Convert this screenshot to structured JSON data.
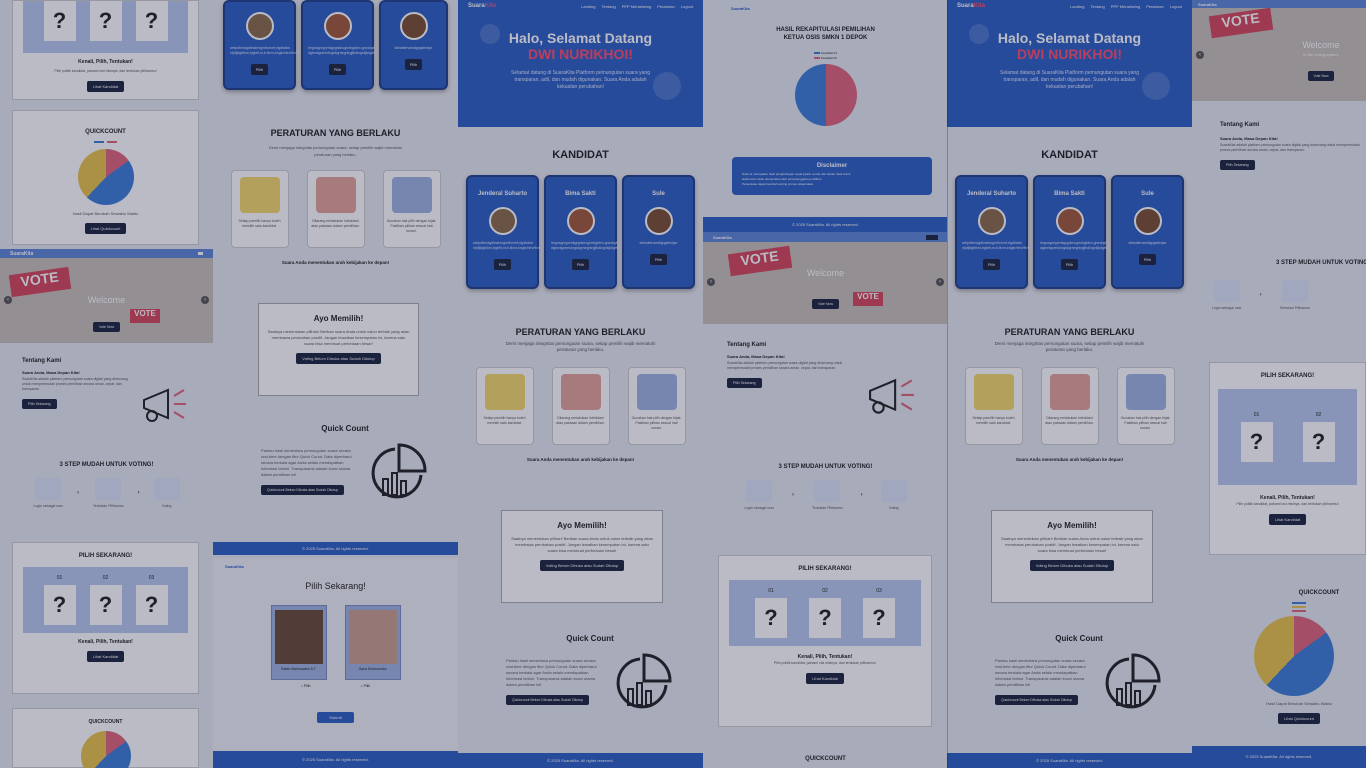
{
  "hero": {
    "brand_prefix": "Suara",
    "brand_suffix": "Kita",
    "nav": [
      "Landing",
      "Tentang",
      "PPP Meraelwing",
      "Peraturan",
      "Logout"
    ],
    "greeting": "Halo, Selamat Datang",
    "user": "DWI NURIKHOI!",
    "intro": "Selamat datang di SuaraKita Platform pemungutan suara yang transparan, adil, dan mudah digunakan. Suara Anda adalah kekuatan perubahan!"
  },
  "candidates": {
    "title": "KANDIDAT",
    "items": [
      {
        "name": "Jenderal Suharto",
        "desc": "welpdfendgdfvwkrngmtfurnrrf,rtgdfwkw nfjdfjdgfdkrn,trgbfrt,nr,b.tkrnr,bngkr/ntrvrfivrfnkrvkhwrkfvkrfg",
        "button": "Pilih"
      },
      {
        "name": "Bima Sakti",
        "desc": "hegnagnrgnrnkgrgnknuglnrbgbkrn,grsrdrgb dgknrkgnerkdngkkgrnegrkrgjfkdkrgnkjkdgtfnkfnf",
        "button": "Pilih"
      },
      {
        "name": "Sule",
        "desc": "sfdwdlerwmdlgrgwfwrjwr",
        "button": "Pilih"
      }
    ]
  },
  "rules": {
    "title": "PERATURAN YANG BERLAKU",
    "subtitle": "Demi menjaga integritas pemungutan suara, setiap pemilih wajib mematuhi peraturan yang berlaku.",
    "items": [
      "Setiap pemilih hanya boleh memilih satu kandidat.",
      "Dilarang melakukan intimidasi atau paksaan dalam pemilihan.",
      "Gunakan hak pilih dengan bijak. Pastikan pilihan sesuai hati nurani."
    ],
    "footnote": "Suara Anda menentukan arah kebijakan ke depan!"
  },
  "ayo": {
    "title": "Ayo Memilih!",
    "text": "Saatnya menentukan pilihan! Berikan suara Anda untuk calon terbaik yang akan membawa perubahan positif. Jangan lewatkan kesempatan ini, karena satu suara bisa membuat perbedaan besar!",
    "button": "Voting Belum Dibuka atau Sudah Ditutup"
  },
  "quick": {
    "title": "Quick Count",
    "text": "Pantau hasil sementara pemungutan suara secara real-time dengan fitur Quick Count. Data diperbarui secara berkala agar Anda selalu mendapatkan informasi terkini. Transparansi adalah kunci utama dalam pemilihan ini!",
    "button": "Quickcount Belum Dibuka atau Sudah Ditutup"
  },
  "footer": "© 2025 SuaraKita. All rights reserved.",
  "recap": {
    "title_1": "HASIL REKAPITULASI PEMILIHAN",
    "title_2": "KETUA OSIS SMKN 1 DEPOK",
    "legend": [
      "Kandidat 01",
      "Kandidat 02"
    ],
    "colors": {
      "a": "#3b7dd8",
      "b": "#e0637c"
    },
    "disclaimer_title": "Disclaimer",
    "disclaimer_lines": [
      "Data ini merupakan hasil penghitungan cepat (quick count) dan bukan hasil resmi.",
      "Hasil resmi akan diumumkan oleh penyelenggara pemilihan.",
      "Persentase dapat berubah seiring proses rekapitulasi."
    ]
  },
  "welcome": {
    "word": "Welcome",
    "sub": "to the voting system",
    "button": "Vote Now"
  },
  "about": {
    "title": "Tentang Kami",
    "heading": "Suara Anda, Masa Depan Kita!",
    "text": "SuaraKita adalah platform pemungutan suara digital yang dirancang untuk mempermudah proses pemilihan secara aman, cepat, dan transparan.",
    "button": "Pilih Sekarang"
  },
  "steps": {
    "title": "3 STEP MUDAH UNTUK VOTING!",
    "items": [
      "Login sebagai user",
      "Tentukan Pilihanmu",
      "Voting"
    ]
  },
  "pick": {
    "title": "PILIH SEKARANG!",
    "numbers": [
      "01",
      "02",
      "03"
    ],
    "mark": "?",
    "cta": "Kenali, Pilih, Tentukan!",
    "note": "Pilih politik kandidat, pahami visi misinya, dan tentukan pilihanmu!",
    "button": "Lihat Kandidat"
  },
  "quickcount": {
    "title": "QUICKCOUNT",
    "label": "Hasil Dapat Berubah Sewaktu Waktu",
    "button": "Lihat Quickcount",
    "colors": {
      "a": "#3b7dd8",
      "b": "#e8c34b",
      "c": "#e0637c"
    }
  },
  "pilih": {
    "title": "Pilih Sekarang!",
    "names": [
      "Rafah Maheswara S.T",
      "Hana Khairunnisa"
    ],
    "radio": "Pilih",
    "button": "Submit"
  },
  "shared": {
    "logo": "SuaraKita"
  }
}
